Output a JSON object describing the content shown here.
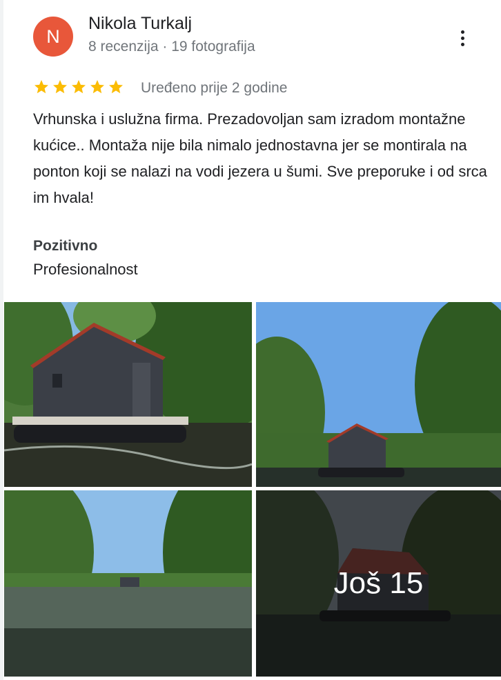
{
  "review": {
    "author_initial": "N",
    "author_name": "Nikola Turkalj",
    "author_meta": "8 recenzija · 19 fotografija",
    "rating": 5,
    "edited": "Uređeno prije 2 godine",
    "text": "Vrhunska i uslužna firma. Prezadovoljan sam izradom montažne kućice.. Montaža nije bila nimalo jednostavna jer se montirala na ponton koji se nalazi na vodi jezera u šumi. Sve preporuke i od srca im hvala!",
    "positive_title": "Pozitivno",
    "positive_value": "Profesionalnost"
  },
  "photos": {
    "more_label": "Još 15"
  },
  "colors": {
    "avatar": "#e8573a",
    "star": "#fbbc04",
    "secondary_text": "#70757a"
  },
  "icons": {
    "more_menu": "more-vert-icon",
    "star": "star-icon"
  }
}
